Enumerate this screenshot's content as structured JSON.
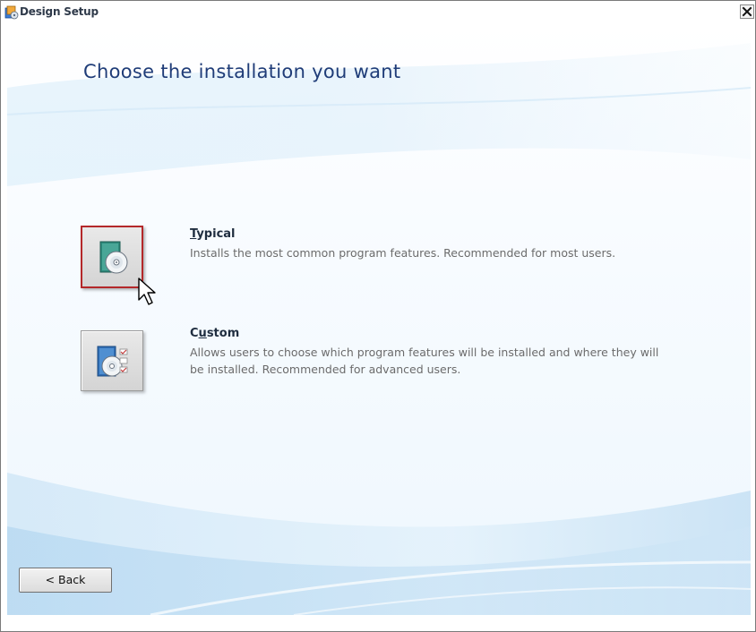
{
  "window": {
    "title": "Design Setup",
    "close_glyph": "✕",
    "app_icon": "setup-icon"
  },
  "page": {
    "title": "Choose the installation you want"
  },
  "options": [
    {
      "id": "typical",
      "heading_mnemonic": "T",
      "heading_rest": "ypical",
      "description": "Installs the most common program features. Recommended for most users.",
      "selected": true,
      "icon": "install-disc-icon"
    },
    {
      "id": "custom",
      "heading_first": "C",
      "heading_mnemonic": "u",
      "heading_rest": "stom",
      "description": "Allows users to choose which program features will be installed and where they will be installed. Recommended for advanced users.",
      "selected": false,
      "icon": "custom-install-disc-icon"
    }
  ],
  "footer": {
    "back_label": "< Back"
  },
  "colors": {
    "title_text": "#1f3c78",
    "selected_border": "#b4282a",
    "description_text": "#6b6b6b"
  }
}
